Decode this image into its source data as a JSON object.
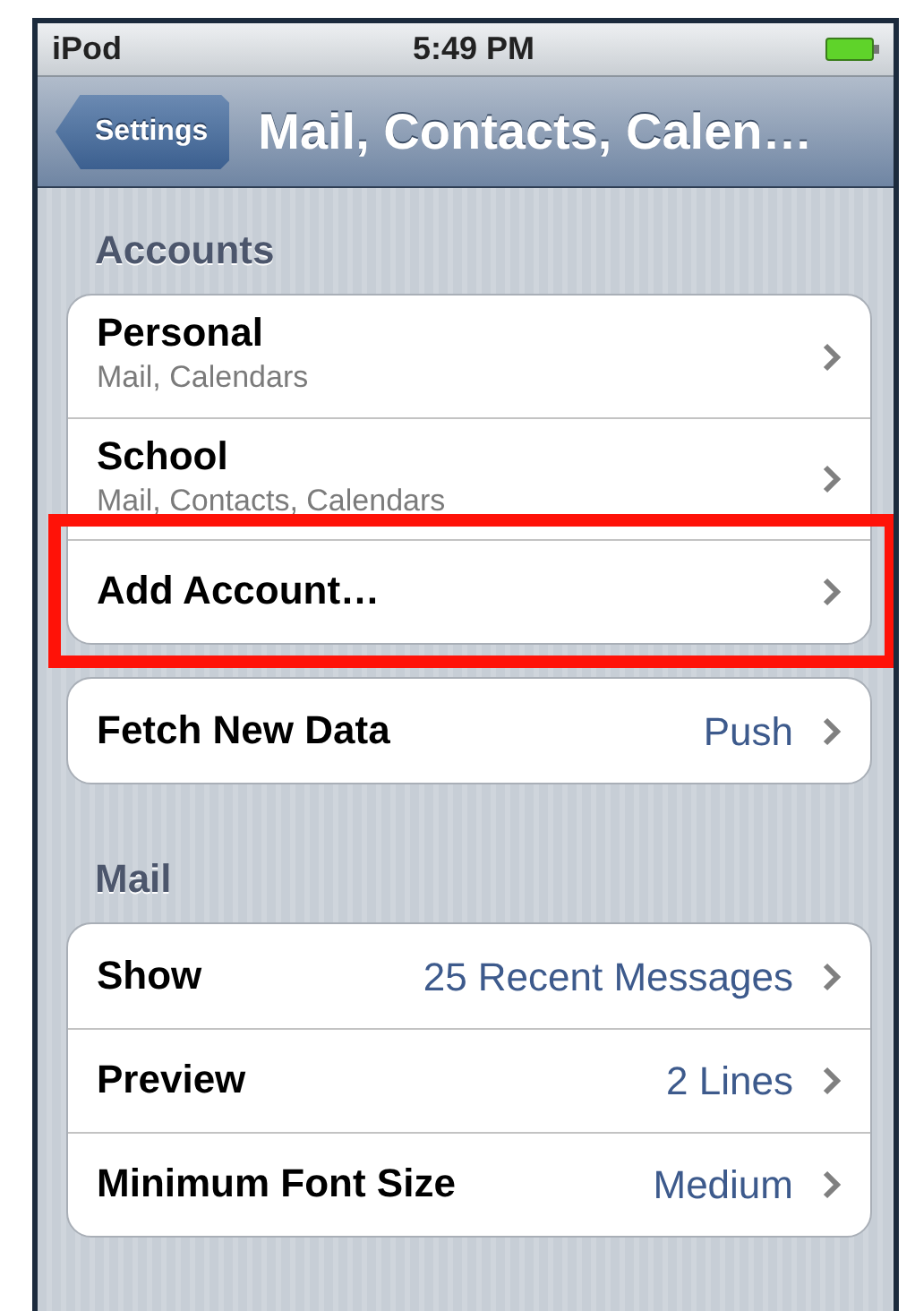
{
  "status_bar": {
    "carrier": "iPod",
    "time": "5:49 PM"
  },
  "nav_bar": {
    "back_button": "Settings",
    "title": "Mail, Contacts, Calen…"
  },
  "sections": [
    {
      "header": "Accounts",
      "groups": [
        {
          "rows": [
            {
              "kind": "account",
              "title": "Personal",
              "subtitle": "Mail, Calendars",
              "highlighted": false
            },
            {
              "kind": "account",
              "title": "School",
              "subtitle": "Mail, Contacts, Calendars",
              "highlighted": false
            },
            {
              "kind": "action",
              "title": "Add Account…",
              "highlighted": true
            }
          ]
        },
        {
          "rows": [
            {
              "kind": "value",
              "title": "Fetch New Data",
              "value": "Push",
              "highlighted": false
            }
          ]
        }
      ]
    },
    {
      "header": "Mail",
      "groups": [
        {
          "rows": [
            {
              "kind": "value",
              "title": "Show",
              "value": "25 Recent Messages",
              "highlighted": false
            },
            {
              "kind": "value",
              "title": "Preview",
              "value": "2 Lines",
              "highlighted": false
            },
            {
              "kind": "value",
              "title": "Minimum Font Size",
              "value": "Medium",
              "highlighted": false
            }
          ]
        }
      ]
    }
  ]
}
